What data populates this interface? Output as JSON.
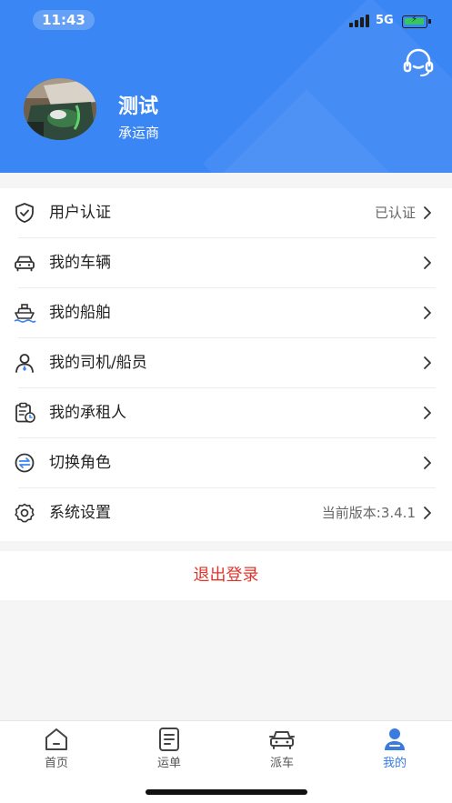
{
  "status_bar": {
    "time": "11:43",
    "network": "5G"
  },
  "profile": {
    "name": "测试",
    "role": "承运商"
  },
  "menu": [
    {
      "label": "用户认证",
      "value": "已认证",
      "icon": "shield-check-icon"
    },
    {
      "label": "我的车辆",
      "value": "",
      "icon": "car-icon"
    },
    {
      "label": "我的船舶",
      "value": "",
      "icon": "ship-icon"
    },
    {
      "label": "我的司机/船员",
      "value": "",
      "icon": "person-icon"
    },
    {
      "label": "我的承租人",
      "value": "",
      "icon": "clipboard-clock-icon"
    },
    {
      "label": "切换角色",
      "value": "",
      "icon": "swap-icon"
    },
    {
      "label": "系统设置",
      "value": "当前版本:3.4.1",
      "icon": "gear-icon"
    }
  ],
  "logout_label": "退出登录",
  "tabs": [
    {
      "label": "首页",
      "icon": "home-icon",
      "active": false
    },
    {
      "label": "运单",
      "icon": "document-icon",
      "active": false
    },
    {
      "label": "派车",
      "icon": "truck-icon",
      "active": false
    },
    {
      "label": "我的",
      "icon": "user-icon",
      "active": true
    }
  ],
  "colors": {
    "primary": "#3a86f5",
    "logout": "#e0352b",
    "active_tab": "#3a7be0"
  }
}
